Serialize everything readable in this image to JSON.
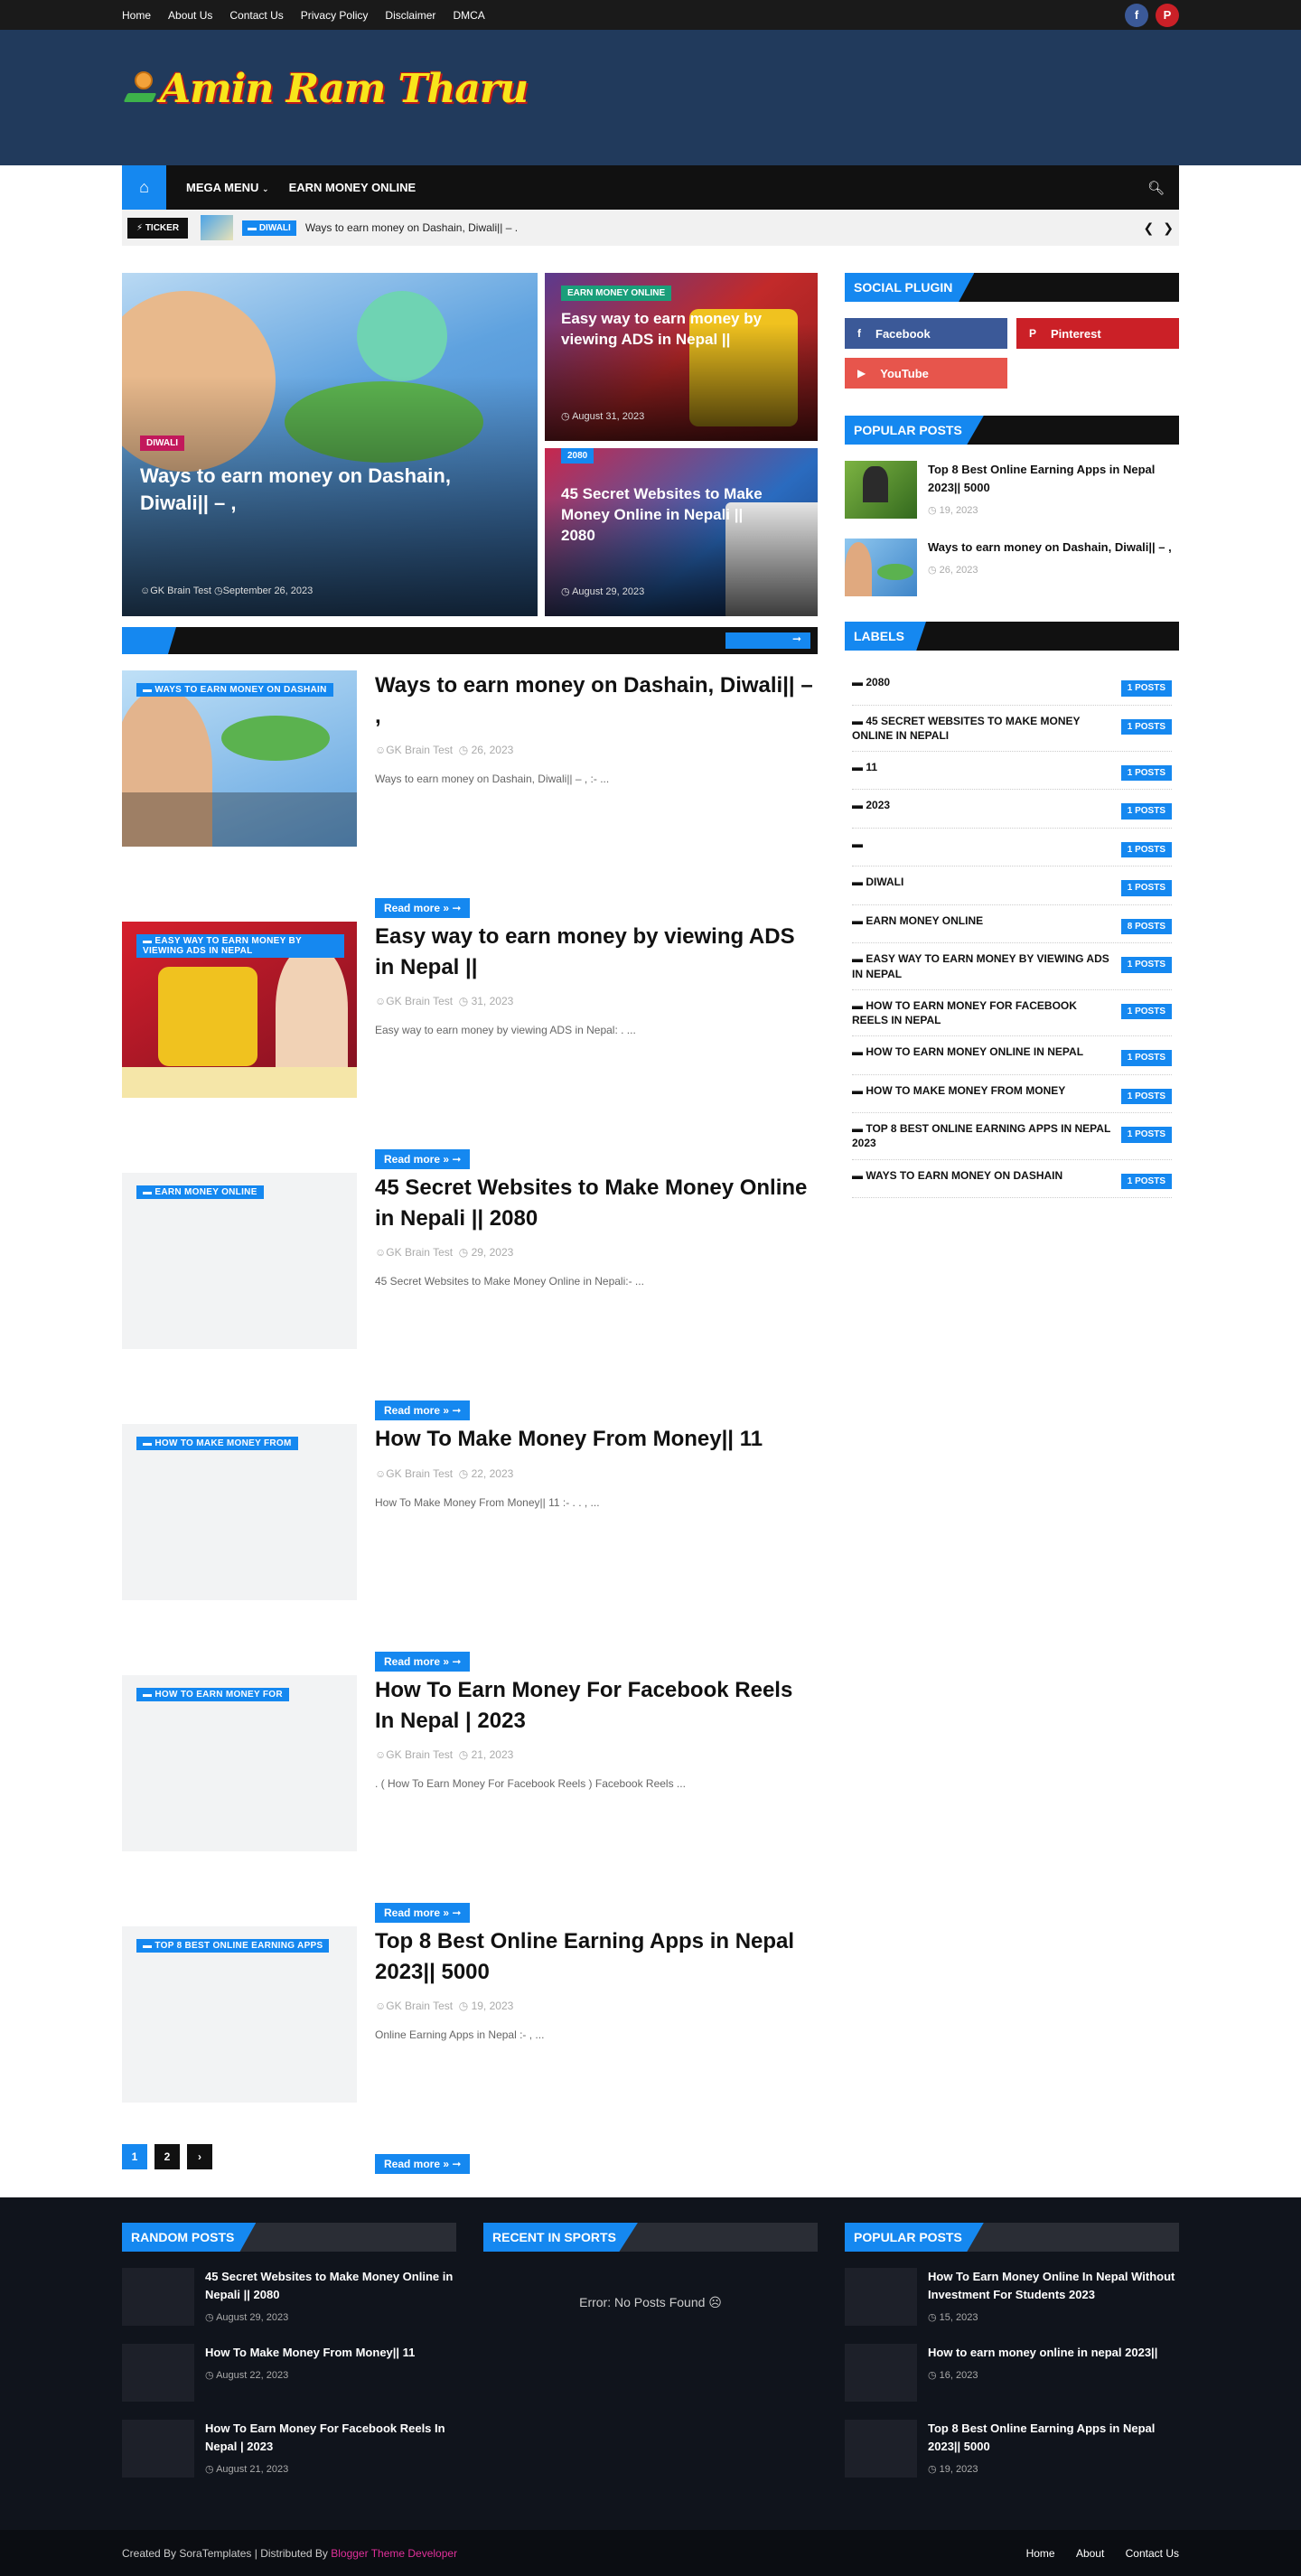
{
  "topbar": {
    "links": [
      "Home",
      "About Us",
      "Contact Us",
      "Privacy Policy",
      "Disclaimer",
      "DMCA"
    ],
    "social": [
      {
        "icon": "facebook-icon",
        "glyph": "f",
        "color": "#3b5998"
      },
      {
        "icon": "pinterest-icon",
        "glyph": "P",
        "color": "#cb2027"
      }
    ]
  },
  "header": {
    "logo_text": "Amin Ram Tharu"
  },
  "nav": {
    "items": [
      {
        "label": "MEGA MENU",
        "has_dropdown": true
      },
      {
        "label": "EARN MONEY ONLINE",
        "has_dropdown": false
      }
    ]
  },
  "ticker": {
    "label": "TICKER",
    "badge": "DIWALI",
    "text": "Ways to earn money on Dashain, Diwali||                                     –                                                      ."
  },
  "featured": {
    "big": {
      "badge": "DIWALI",
      "title": "Ways to earn money on Dashain, Diwali||                    –                          ,",
      "author": "GK Brain Test",
      "date": "September 26, 2023"
    },
    "small1": {
      "badge": "EARN MONEY ONLINE",
      "title": "Easy way to earn money by viewing ADS in Nepal ||",
      "date": "August 31, 2023"
    },
    "small2": {
      "badge": "2080",
      "title": "45 Secret Websites to Make Money Online in Nepali || 2080",
      "date": "August 29, 2023"
    }
  },
  "posts": [
    {
      "badge": "WAYS TO EARN MONEY ON DASHAIN",
      "title": "Ways to earn money on Dashain, Diwali||                     –                      ,",
      "author": "GK Brain Test",
      "date": "26, 2023",
      "excerpt": "Ways to earn money on Dashain, Diwali||                          –                                                                  ,                                               :-          ...",
      "read": "Read more »",
      "thumb": "dashain"
    },
    {
      "badge": "EASY WAY TO EARN MONEY BY VIEWING ADS IN NEPAL",
      "title": "Easy way to earn money by viewing ADS in Nepal ||",
      "author": "GK Brain Test",
      "date": "31, 2023",
      "excerpt": "Easy way to earn money by viewing ADS in Nepal:                    .                                                    ...",
      "read": "Read more »",
      "thumb": "ads"
    },
    {
      "badge": "EARN MONEY ONLINE",
      "title": "45 Secret Websites to Make Money Online in Nepali || 2080",
      "author": "GK Brain Test",
      "date": "29, 2023",
      "excerpt": "45 Secret Websites to Make Money Online in Nepali:-                                                       ...",
      "read": "Read more »",
      "thumb": "blank"
    },
    {
      "badge": "HOW TO MAKE MONEY FROM",
      "title": "How To Make Money From Money||                                     11",
      "author": "GK Brain Test",
      "date": "22, 2023",
      "excerpt": "How To Make Money From Money||                                          11          :-                                .                                              .              ,             ...",
      "read": "Read more »",
      "thumb": "blank"
    },
    {
      "badge": "HOW TO EARN MONEY FOR",
      "title": "How To Earn Money For Facebook Reels In Nepal |                                                     2023",
      "author": "GK Brain Test",
      "date": "21, 2023",
      "excerpt": "                          .                                       ( How To Earn Money For Facebook Reels ) Facebook Reels                                                   ...",
      "read": "Read more »",
      "thumb": "blank"
    },
    {
      "badge": "TOP 8 BEST ONLINE EARNING APPS",
      "title": "Top 8 Best Online Earning Apps in Nepal 2023||              5000",
      "author": "GK Brain Test",
      "date": "19, 2023",
      "excerpt": "Online Earning Apps in Nepal :-                                                                 ,                          ...",
      "read": "Read more »",
      "thumb": "blank"
    }
  ],
  "pager": [
    "1",
    "2",
    "›"
  ],
  "sidebar": {
    "social_heading": "SOCIAL PLUGIN",
    "social": [
      {
        "label": "Facebook",
        "glyph": "f",
        "color": "#3b5998"
      },
      {
        "label": "Pinterest",
        "glyph": "P",
        "color": "#cb2027"
      },
      {
        "label": "YouTube",
        "glyph": "▶",
        "color": "#e7554c"
      }
    ],
    "popular_heading": "POPULAR POSTS",
    "popular": [
      {
        "title": "Top 8 Best Online Earning Apps in Nepal 2023||               5000",
        "date": "19, 2023",
        "thumb": "apps"
      },
      {
        "title": "Ways to earn money on Dashain, Diwali||                       –                        ,",
        "date": "26, 2023",
        "thumb": "dashain"
      }
    ],
    "labels_heading": "LABELS",
    "labels": [
      {
        "name": "2080",
        "count": "1 POSTS"
      },
      {
        "name": "45 SECRET WEBSITES TO MAKE MONEY ONLINE IN NEPALI",
        "count": "1 POSTS"
      },
      {
        "name": "                              11",
        "count": "1 POSTS"
      },
      {
        "name": "                                        2023",
        "count": "1 POSTS"
      },
      {
        "name": " ",
        "count": "1 POSTS"
      },
      {
        "name": "DIWALI",
        "count": "1 POSTS"
      },
      {
        "name": "EARN MONEY ONLINE",
        "count": "8 POSTS"
      },
      {
        "name": "EASY WAY TO EARN MONEY BY VIEWING ADS IN NEPAL",
        "count": "1 POSTS"
      },
      {
        "name": "HOW TO EARN MONEY FOR FACEBOOK REELS IN NEPAL",
        "count": "1 POSTS"
      },
      {
        "name": "HOW TO EARN MONEY ONLINE IN NEPAL",
        "count": "1 POSTS"
      },
      {
        "name": "HOW TO MAKE MONEY FROM MONEY",
        "count": "1 POSTS"
      },
      {
        "name": "TOP 8 BEST ONLINE EARNING APPS IN NEPAL 2023",
        "count": "1 POSTS"
      },
      {
        "name": "WAYS TO EARN MONEY ON DASHAIN",
        "count": "1 POSTS"
      }
    ]
  },
  "footer": {
    "random_heading": "RANDOM POSTS",
    "random": [
      {
        "title": "45 Secret Websites to Make Money Online in Nepali || 2080",
        "date": "August 29, 2023"
      },
      {
        "title": "How To Make Money From Money||                              11",
        "date": "August 22, 2023"
      },
      {
        "title": "How To Earn Money For Facebook Reels In Nepal |                          2023",
        "date": "August 21, 2023"
      }
    ],
    "sports_heading": "RECENT IN SPORTS",
    "sports_error": "Error: No Posts Found ☹",
    "popular_heading": "POPULAR POSTS",
    "popular": [
      {
        "title": "How To Earn Money Online In Nepal Without Investment For Students 2023",
        "date": "15, 2023"
      },
      {
        "title": "How to earn money online in nepal 2023||",
        "date": "16, 2023"
      },
      {
        "title": "Top 8 Best Online Earning Apps in Nepal 2023||               5000",
        "date": "19, 2023"
      }
    ]
  },
  "bottom": {
    "credit_prefix": "Created By SoraTemplates | Distributed By ",
    "credit_link": "Blogger Theme Developer",
    "links": [
      "Home",
      "About",
      "Contact Us"
    ]
  },
  "colors": {
    "accent": "#1588f0",
    "header_bg": "#213a5c",
    "dark": "#111111",
    "footer_bg": "#10141c",
    "credit_link": "#e0309a"
  }
}
